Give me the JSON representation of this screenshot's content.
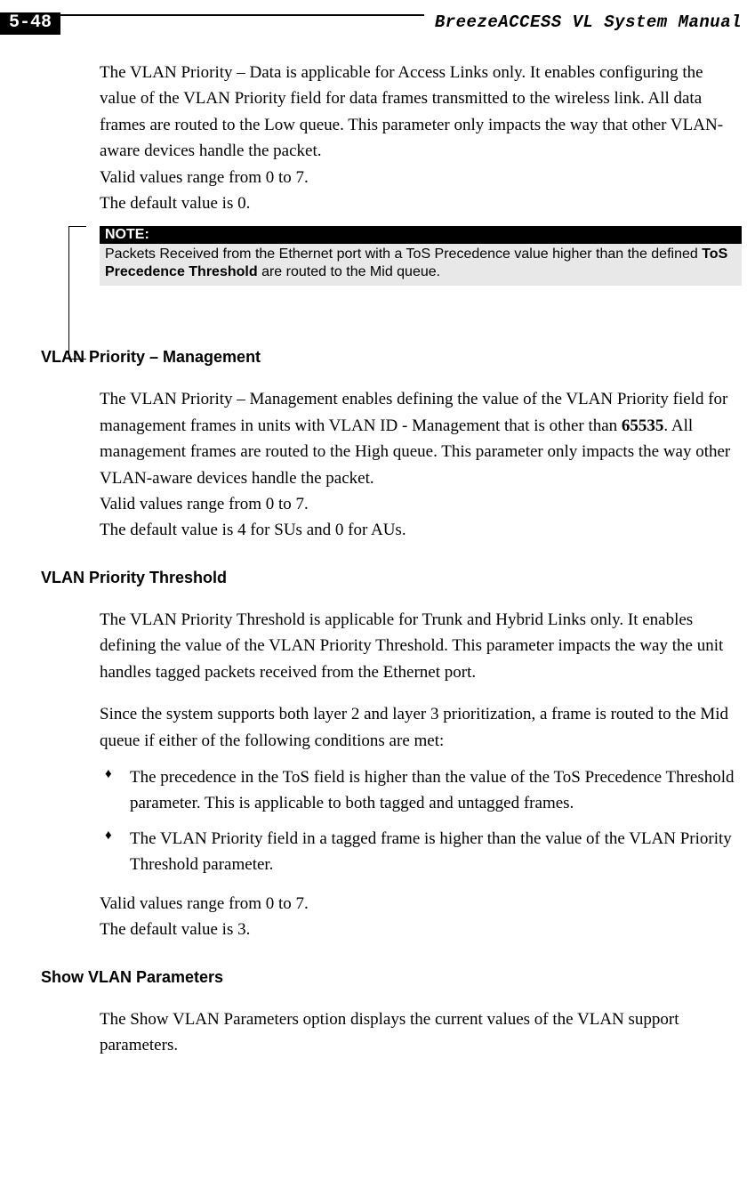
{
  "header": {
    "page_number": "5-48",
    "manual_title": "BreezeACCESS VL System Manual"
  },
  "intro": {
    "p1": "The VLAN Priority – Data is applicable for Access Links only. It enables configuring the value of the VLAN Priority field for data frames transmitted to the wireless link. All data frames are routed to the Low queue. This parameter only impacts the way that other VLAN-aware devices handle the packet.",
    "p2": "Valid values range from 0 to 7.",
    "p3": "The default value is 0."
  },
  "note": {
    "label": "NOTE:",
    "body_before": "Packets Received from the Ethernet port with a ToS Precedence value higher than the defined ",
    "body_bold": "ToS Precedence Threshold",
    "body_after": " are routed to the Mid queue."
  },
  "sections": {
    "s1": {
      "title": "VLAN Priority – Management",
      "p1a": "The VLAN Priority – Management enables defining the value of the VLAN Priority field for management frames in units with VLAN ID - Management that is other than ",
      "p1_bold": "65535",
      "p1b": ". All management frames are routed to the High queue. This parameter only impacts the way other VLAN-aware devices handle the packet.",
      "p2": "Valid values range from 0 to 7.",
      "p3": "The default value is 4 for SUs and 0 for AUs."
    },
    "s2": {
      "title": "VLAN Priority Threshold",
      "p1": "The VLAN Priority Threshold is applicable for Trunk and Hybrid Links only. It enables defining the value of the VLAN Priority Threshold. This parameter impacts the way the unit handles tagged packets received from the Ethernet port.",
      "p2": "Since the system supports both layer 2 and layer 3 prioritization, a frame is routed to the Mid queue if either of the following conditions are met:",
      "bullets": [
        "The precedence in the ToS field is higher than the value of the ToS Precedence Threshold parameter. This is applicable to both tagged and untagged frames.",
        "The VLAN Priority field in a tagged frame is higher than the value of the VLAN Priority Threshold parameter."
      ],
      "p3": "Valid values range from 0 to 7.",
      "p4": "The default value is 3."
    },
    "s3": {
      "title": "Show VLAN Parameters",
      "p1": "The Show VLAN Parameters option displays the current values of the VLAN support parameters."
    }
  }
}
